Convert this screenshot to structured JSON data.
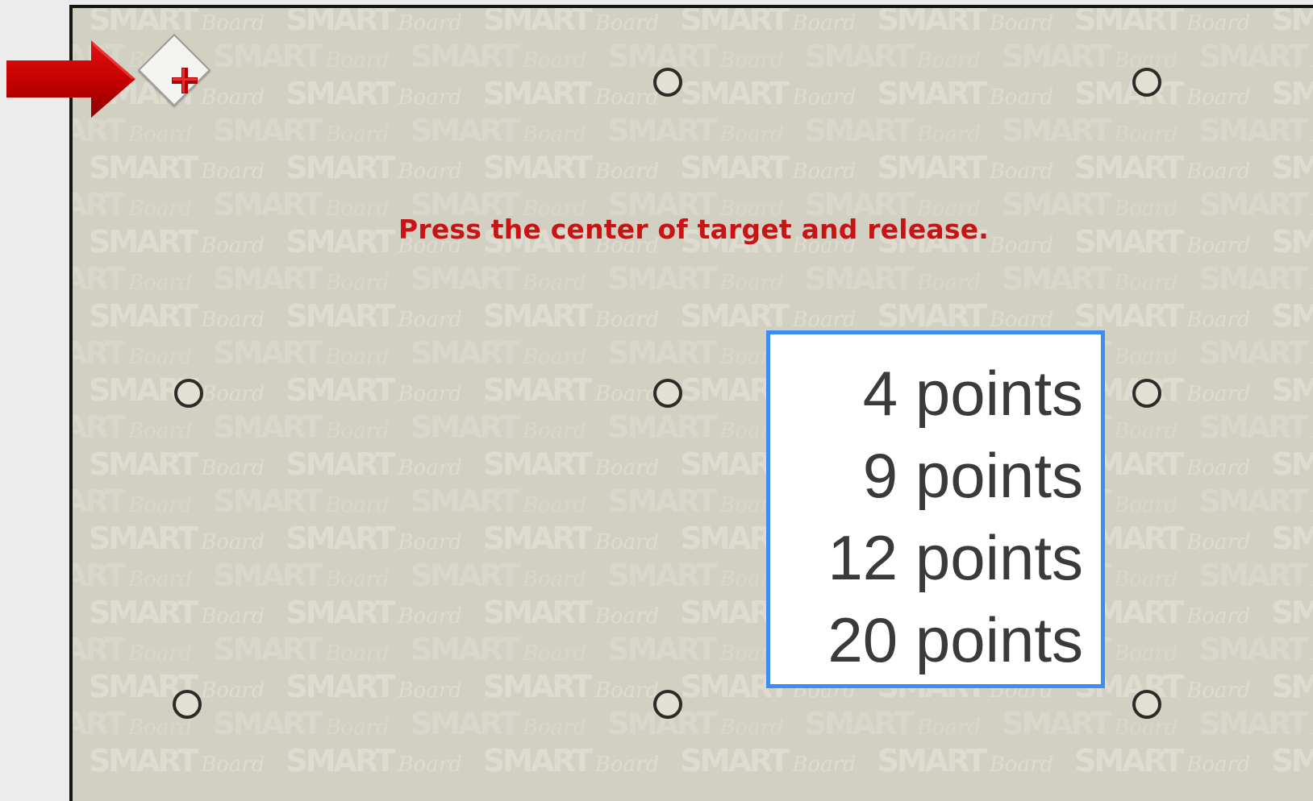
{
  "instruction": "Press the center of target and release.",
  "watermark": {
    "brand": "SMART",
    "sub": "Board"
  },
  "calibration_points": {
    "options": [
      "4 points",
      "9 points",
      "12 points",
      "20 points"
    ]
  },
  "colors": {
    "instruction_red": "#c81414",
    "arrow_red": "#cc0000",
    "box_border": "#3d8ef0",
    "board_bg": "#d2d0c2"
  },
  "icons": {
    "arrow": "right-arrow-icon",
    "active_target": "crosshair-target-icon",
    "target": "target-circle-icon"
  }
}
